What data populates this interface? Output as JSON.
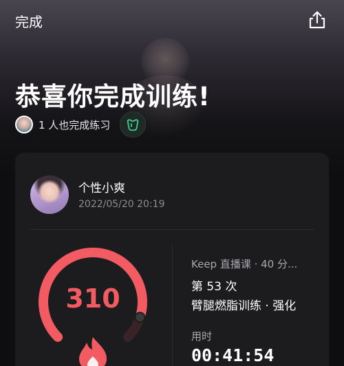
{
  "header": {
    "done_label": "完成",
    "share_icon": "share-icon"
  },
  "hero": {
    "title": "恭喜你完成训练!",
    "completed_text": "1 人也完成练习",
    "like_icon": "thumbs-up-icon"
  },
  "record": {
    "username": "个性小爽",
    "timestamp": "2022/05/20 20:19",
    "calories": "310",
    "calories_progress": 0.9,
    "course_source": "Keep 直播课 · 40 分...",
    "session_count": "第 53 次",
    "course_name": "臂腿燃脂训练 · 强化",
    "duration_label": "用时",
    "duration_value": "00:41:54"
  },
  "colors": {
    "accent_red": "#f35b63",
    "accent_green": "#3ecf8e",
    "background": "#0e0e10",
    "card": "#1c1c1e"
  }
}
